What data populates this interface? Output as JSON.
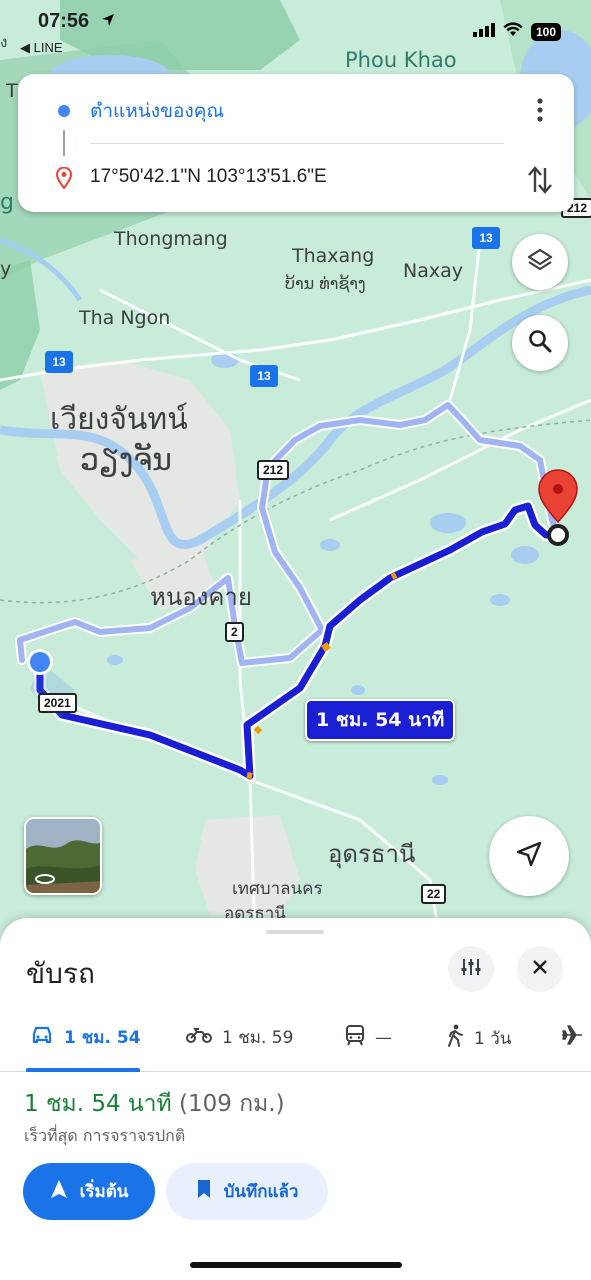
{
  "status_bar": {
    "time": "07:56",
    "back_app": "◀ LINE",
    "battery": "100"
  },
  "map": {
    "labels": {
      "phou_khao": "Phou Khao",
      "thongmang": "Thongmang",
      "thaxang": "Thaxang",
      "thaxang_lao": "ບ້ານ ທ່າຊ້າງ",
      "naxay": "Naxay",
      "tha_ngon": "Tha Ngon",
      "vientiane_th": "เวียงจันทน์",
      "vientiane_lao": "ວຽງຈັນ",
      "nong_khai": "หนองคาย",
      "udon_thani": "อุดรธานี",
      "thesaban": "เทศบาลนคร",
      "thesaban2": "อุดรธานี",
      "edge_g": "g",
      "edge_t": "T",
      "edge_y": "y",
      "edge_ng": "ง"
    },
    "highway_shields": [
      "13",
      "13",
      "13"
    ],
    "route_shields": [
      "212",
      "212",
      "2",
      "2021",
      "22"
    ],
    "eta_badge": "1 ชม. 54 นาที",
    "route_color": "#1a1fd4",
    "alt_route_color": "#9fb4f0"
  },
  "directions": {
    "origin": "ตำแหน่งของคุณ",
    "destination": "17°50'42.1\"N 103°13'51.6\"E",
    "more_icon": "more-vert-icon",
    "swap_icon": "swap-vert-icon"
  },
  "controls": {
    "layers_icon": "layers-icon",
    "search_icon": "search-icon",
    "locate_icon": "navigation-arrow-icon"
  },
  "sheet": {
    "title": "ขับรถ",
    "tabs": [
      {
        "label": "1 ชม. 54",
        "icon": "car-icon",
        "active": true
      },
      {
        "label": "1 ชม. 59",
        "icon": "motorcycle-icon",
        "active": false
      },
      {
        "label": "—",
        "icon": "transit-icon",
        "active": false
      },
      {
        "label": "1 วัน",
        "icon": "walk-icon",
        "active": false
      },
      {
        "label": "",
        "icon": "flight-icon",
        "active": false
      }
    ],
    "duration": "1 ชม. 54 นาที",
    "distance": "(109 กม.)",
    "subtext": "เร็วที่สุด การจราจรปกติ",
    "start_label": "เริ่มต้น",
    "saved_label": "บันทึกแล้ว"
  }
}
